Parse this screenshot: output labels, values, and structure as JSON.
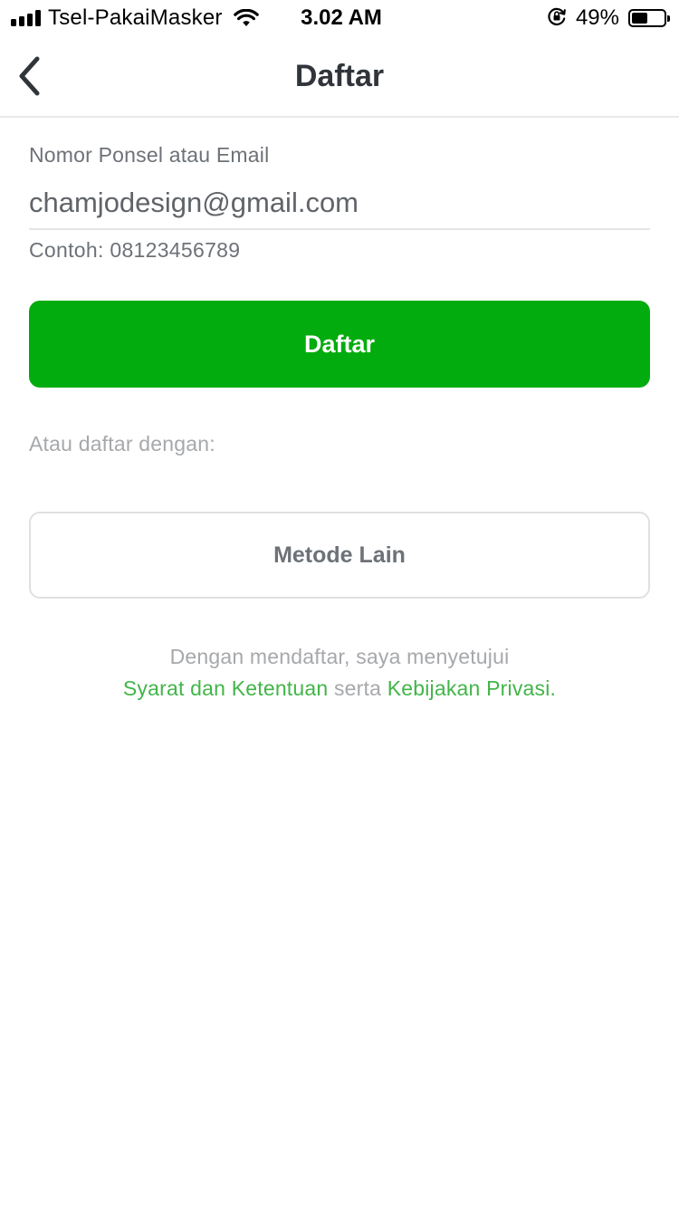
{
  "status_bar": {
    "carrier": "Tsel-PakaiMasker",
    "time": "3.02 AM",
    "battery_percent": "49%",
    "battery_level": 0.49,
    "icons": [
      "signal-icon",
      "wifi-icon",
      "orientation-lock-icon",
      "battery-icon"
    ]
  },
  "header": {
    "title": "Daftar",
    "back_icon": "chevron-left-icon"
  },
  "form": {
    "label": "Nomor Ponsel atau Email",
    "value": "chamjodesign@gmail.com",
    "hint": "Contoh: 08123456789"
  },
  "register_button": {
    "label": "Daftar"
  },
  "alternative": {
    "label": "Atau daftar dengan:",
    "button_label": "Metode Lain"
  },
  "terms": {
    "line1": "Dengan mendaftar, saya menyetujui",
    "terms_link": "Syarat dan Ketentuan",
    "conjunction": "serta",
    "privacy_link": "Kebijakan Privasi",
    "period": "."
  },
  "colors": {
    "primary_green": "#03ac0e",
    "link_green": "#42b549",
    "title_text": "#31353b",
    "secondary_text": "#6d7278",
    "muted_text": "#a6a8ab"
  }
}
